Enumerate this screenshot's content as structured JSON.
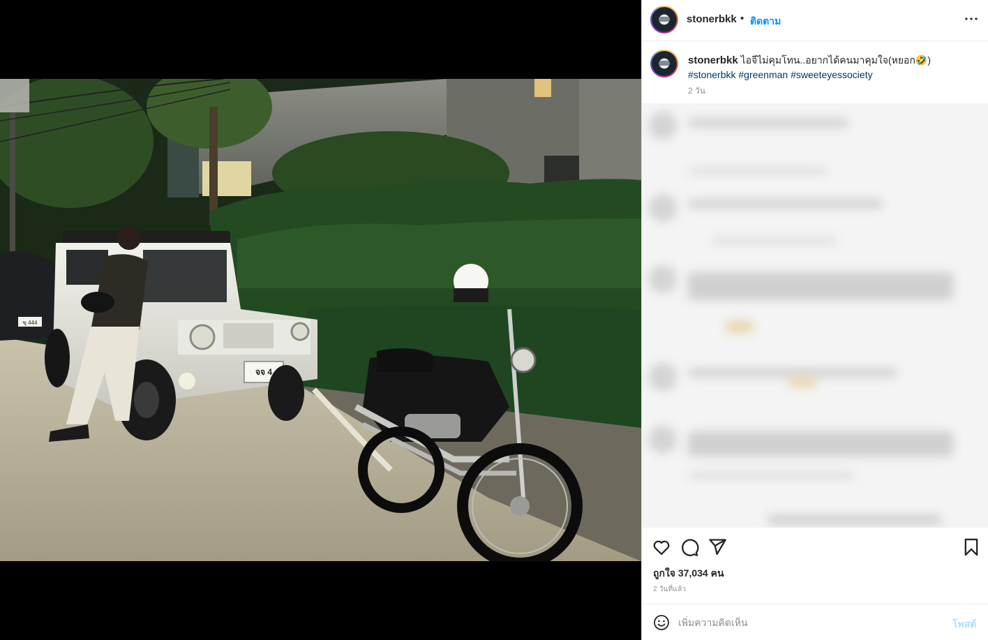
{
  "post": {
    "username": "stonerbkk",
    "dot": "•",
    "follow_label": "ติดตาม",
    "more_icon": "more-options-icon",
    "caption_text": "ไอจีไม่คุมโทน..อยากได้คนมาคุมใจ(หยอก🤣)",
    "hashtags": [
      "#stonerbkk",
      "#greenman",
      "#sweeteyessociety"
    ],
    "caption_time": "2 วัน",
    "likes": "ถูกใจ 37,034 คน",
    "posted_ago": "2 วันที่แล้ว",
    "comment_placeholder": "เพิ่มความคิดเห็น",
    "post_label": "โพสต์",
    "photo_plate_number": "จจ 4",
    "photo_plate_left": "ขุ 444"
  },
  "colors": {
    "follow_blue": "#0095f6",
    "hashtag_blue": "#00376b",
    "post_disabled": "#b2dffc",
    "muted": "#8e8e8e"
  }
}
